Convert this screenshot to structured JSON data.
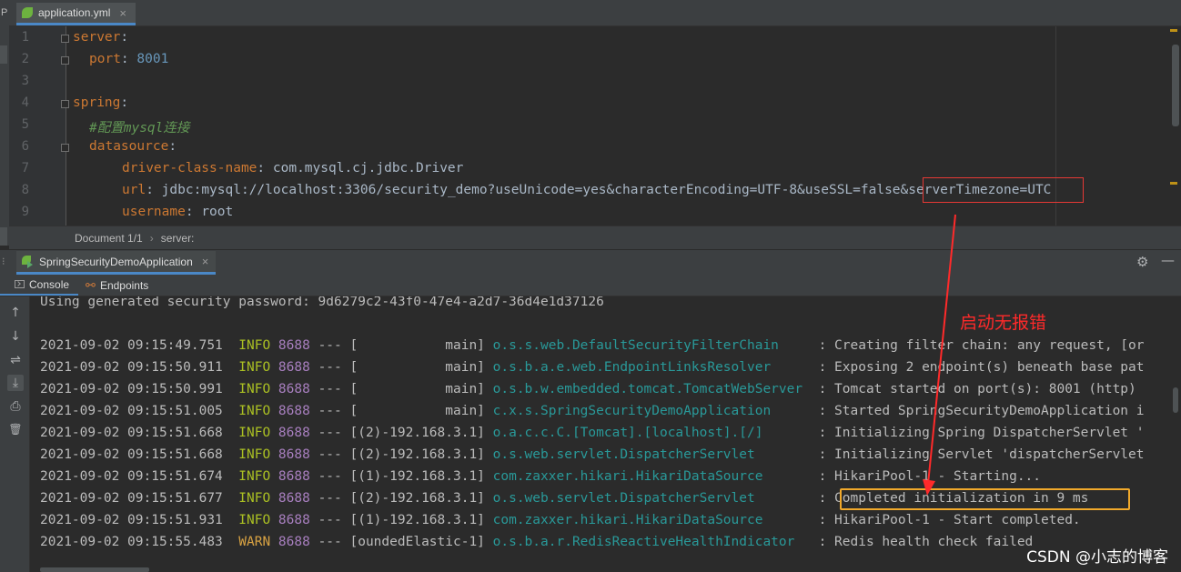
{
  "left_strip": {
    "letter": "P"
  },
  "editor_tab": {
    "filename": "application.yml",
    "close": "×"
  },
  "editor": {
    "lines": [
      {
        "num": "1",
        "key": "server",
        "sep": ":",
        "value": ""
      },
      {
        "num": "2",
        "key": "port",
        "sep": ": ",
        "value": "8001"
      },
      {
        "num": "3"
      },
      {
        "num": "4",
        "key": "spring",
        "sep": ":",
        "value": ""
      },
      {
        "num": "5",
        "comment": "#配置mysql连接"
      },
      {
        "num": "6",
        "key": "datasource",
        "sep": ":",
        "value": ""
      },
      {
        "num": "7",
        "key": "driver-class-name",
        "sep": ": ",
        "value": "com.mysql.cj.jdbc.Driver"
      },
      {
        "num": "8",
        "key": "url",
        "sep": ": ",
        "value": "jdbc:mysql://localhost:3306/security_demo?useUnicode=yes&characterEncoding=UTF-8&useSSL=false&serverTimezone=UTC"
      },
      {
        "num": "9",
        "key": "username",
        "sep": ": ",
        "value": "root"
      }
    ]
  },
  "breadcrumb": {
    "document": "Document 1/1",
    "sep": "›",
    "path": "server:"
  },
  "run_tab": {
    "label": "SpringSecurityDemoApplication",
    "close": "×"
  },
  "console_tabs": {
    "console": "Console",
    "endpoints": "Endpoints"
  },
  "icons": {
    "gear": "⚙",
    "minimize": "—",
    "up": "↑",
    "down": "↓",
    "wrap": "⇌",
    "scroll_end": "⤓",
    "print": "⎙",
    "trash": "🗑"
  },
  "console": {
    "first_line": "Using generated security password: 9d6279c2-43f0-47e4-a2d7-36d4e1d37126",
    "lines": [
      {
        "ts": "2021-09-02 09:15:49.751",
        "level": "INFO",
        "pid": "8688",
        "thread": "--- [           main]",
        "logger": "o.s.s.web.DefaultSecurityFilterChain    ",
        "msg": ": Creating filter chain: any request, [or"
      },
      {
        "ts": "2021-09-02 09:15:50.911",
        "level": "INFO",
        "pid": "8688",
        "thread": "--- [           main]",
        "logger": "o.s.b.a.e.web.EndpointLinksResolver     ",
        "msg": ": Exposing 2 endpoint(s) beneath base pat"
      },
      {
        "ts": "2021-09-02 09:15:50.991",
        "level": "INFO",
        "pid": "8688",
        "thread": "--- [           main]",
        "logger": "o.s.b.w.embedded.tomcat.TomcatWebServer ",
        "msg": ": Tomcat started on port(s): 8001 (http)"
      },
      {
        "ts": "2021-09-02 09:15:51.005",
        "level": "INFO",
        "pid": "8688",
        "thread": "--- [           main]",
        "logger": "c.x.s.SpringSecurityDemoApplication     ",
        "msg": ": Started SpringSecurityDemoApplication i"
      },
      {
        "ts": "2021-09-02 09:15:51.668",
        "level": "INFO",
        "pid": "8688",
        "thread": "--- [(2)-192.168.3.1]",
        "logger": "o.a.c.c.C.[Tomcat].[localhost].[/]      ",
        "msg": ": Initializing Spring DispatcherServlet '"
      },
      {
        "ts": "2021-09-02 09:15:51.668",
        "level": "INFO",
        "pid": "8688",
        "thread": "--- [(2)-192.168.3.1]",
        "logger": "o.s.web.servlet.DispatcherServlet       ",
        "msg": ": Initializing Servlet 'dispatcherServlet"
      },
      {
        "ts": "2021-09-02 09:15:51.674",
        "level": "INFO",
        "pid": "8688",
        "thread": "--- [(1)-192.168.3.1]",
        "logger": "com.zaxxer.hikari.HikariDataSource      ",
        "msg": ": HikariPool-1 - Starting..."
      },
      {
        "ts": "2021-09-02 09:15:51.677",
        "level": "INFO",
        "pid": "8688",
        "thread": "--- [(2)-192.168.3.1]",
        "logger": "o.s.web.servlet.DispatcherServlet       ",
        "msg": ": Completed initialization in 9 ms"
      },
      {
        "ts": "2021-09-02 09:15:51.931",
        "level": "INFO",
        "pid": "8688",
        "thread": "--- [(1)-192.168.3.1]",
        "logger": "com.zaxxer.hikari.HikariDataSource      ",
        "msg": ": HikariPool-1 - Start completed."
      },
      {
        "ts": "2021-09-02 09:15:55.483",
        "level": "WARN",
        "pid": "8688",
        "thread": "--- [oundedElastic-1]",
        "logger": "o.s.b.a.r.RedisReactiveHealthIndicator  ",
        "msg": ": Redis health check failed"
      }
    ]
  },
  "annotation": {
    "text": "启动无报错",
    "color": "#ff2a2a"
  },
  "watermark": "CSDN @小志的博客",
  "colors": {
    "info": "#abc023",
    "warn": "#d9a343",
    "logger": "#299999",
    "pid": "#a87fbf",
    "key": "#cc7832",
    "number": "#6897bb",
    "comment": "#629755",
    "highlight_red": "#e53935",
    "highlight_yellow": "#f1a92b"
  }
}
